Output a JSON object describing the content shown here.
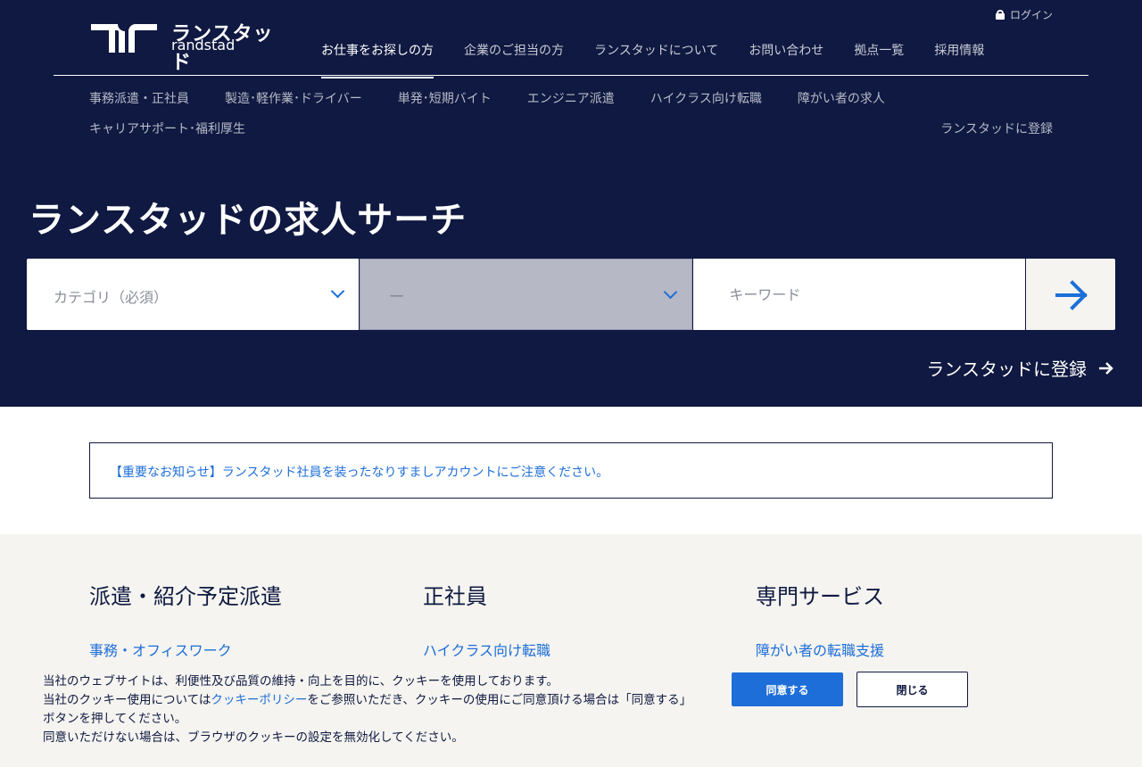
{
  "logo": {
    "jp": "ランスタッド",
    "en": "randstad"
  },
  "login": {
    "label": "ログイン"
  },
  "mainnav": [
    "お仕事をお探しの方",
    "企業のご担当の方",
    "ランスタッドについて",
    "お問い合わせ",
    "拠点一覧",
    "採用情報"
  ],
  "subnav": [
    "事務派遣・正社員",
    "製造･軽作業･ドライバー",
    "単発･短期バイト",
    "エンジニア派遣",
    "ハイクラス向け転職",
    "障がい者の求人"
  ],
  "subnav2": "キャリアサポート･福利厚生",
  "register_top": "ランスタッドに登録",
  "hero": {
    "title": "ランスタッドの求人サーチ"
  },
  "search": {
    "category_placeholder": "カテゴリ（必須）",
    "sub_placeholder": "ー",
    "keyword_placeholder": "キーワード"
  },
  "register_hero": "ランスタッドに登録",
  "notice": "【重要なお知らせ】ランスタッド社員を装ったなりすましアカウントにご注意ください。",
  "categories": [
    {
      "title": "派遣・紹介予定派遣",
      "link": "事務・オフィスワーク"
    },
    {
      "title": "正社員",
      "link": "ハイクラス向け転職"
    },
    {
      "title": "専門サービス",
      "link": "障がい者の転職支援"
    }
  ],
  "cookie": {
    "line1": "当社のウェブサイトは、利便性及び品質の維持・向上を目的に、クッキーを使用しております。",
    "line2_pre": "当社のクッキー使用については",
    "line2_link": "クッキーポリシー",
    "line2_post": "をご参照いただき、クッキーの使用にご同意頂ける場合は「同意する」ボタンを押してください。",
    "line3": "同意いただけない場合は、ブラウザのクッキーの設定を無効化してください。",
    "agree": "同意する",
    "close": "閉じる"
  },
  "colors": {
    "navy": "#0f1941",
    "blue": "#1d6ed8",
    "beige": "#f5f4f0"
  }
}
